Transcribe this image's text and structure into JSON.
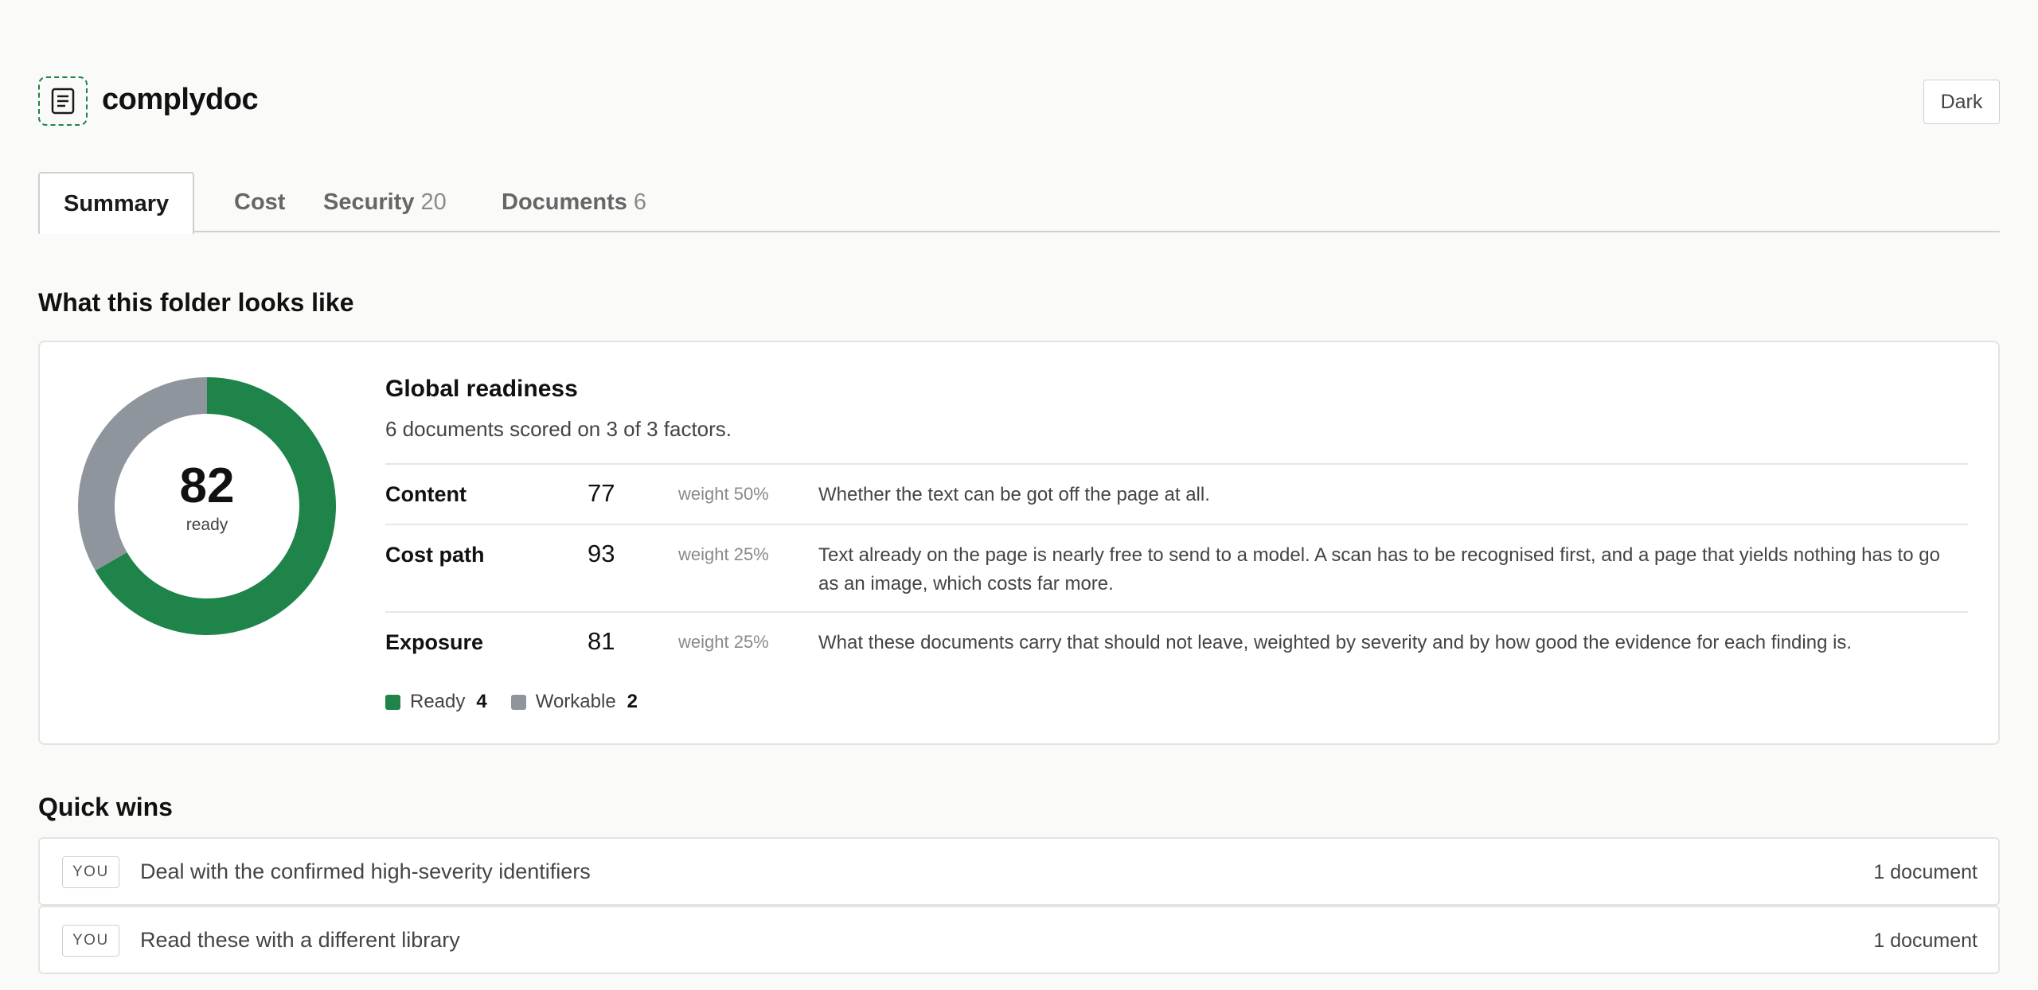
{
  "app": {
    "name": "complydoc",
    "theme_toggle_label": "Dark",
    "logo_icon": "document-icon"
  },
  "tabs": [
    {
      "label": "Summary",
      "count": "",
      "active": true
    },
    {
      "label": "Cost",
      "count": "",
      "active": false
    },
    {
      "label": "Security",
      "count": "20",
      "active": false
    },
    {
      "label": "Documents",
      "count": "6",
      "active": false
    }
  ],
  "overview": {
    "heading": "What this folder looks like",
    "score": "82",
    "score_label": "ready",
    "title": "Global readiness",
    "subtitle": "6 documents scored on 3 of 3 factors.",
    "factors": [
      {
        "name": "Content",
        "score": "77",
        "weight": "weight 50%",
        "description": "Whether the text can be got off the page at all."
      },
      {
        "name": "Cost path",
        "score": "93",
        "weight": "weight 25%",
        "description": "Text already on the page is nearly free to send to a model. A scan has to be recognised first, and a page that yields nothing has to go as an image, which costs far more."
      },
      {
        "name": "Exposure",
        "score": "81",
        "weight": "weight 25%",
        "description": "What these documents carry that should not leave, weighted by severity and by how good the evidence for each finding is."
      }
    ],
    "legend": [
      {
        "label": "Ready",
        "count": "4",
        "color": "#1e8449"
      },
      {
        "label": "Workable",
        "count": "2",
        "color": "#8e959c"
      }
    ],
    "distribution": [
      {
        "label": "Ready",
        "value": 4,
        "color": "#1e8449"
      },
      {
        "label": "Workable",
        "value": 2,
        "color": "#8e959c"
      }
    ]
  },
  "quick_wins": {
    "heading": "Quick wins",
    "items": [
      {
        "tag": "YOU",
        "text": "Deal with the confirmed high-severity identifiers",
        "meta": "1 document"
      },
      {
        "tag": "YOU",
        "text": "Read these with a different library",
        "meta": "1 document"
      }
    ]
  },
  "colors": {
    "accent": "#1e8449",
    "neutral": "#8e959c"
  }
}
